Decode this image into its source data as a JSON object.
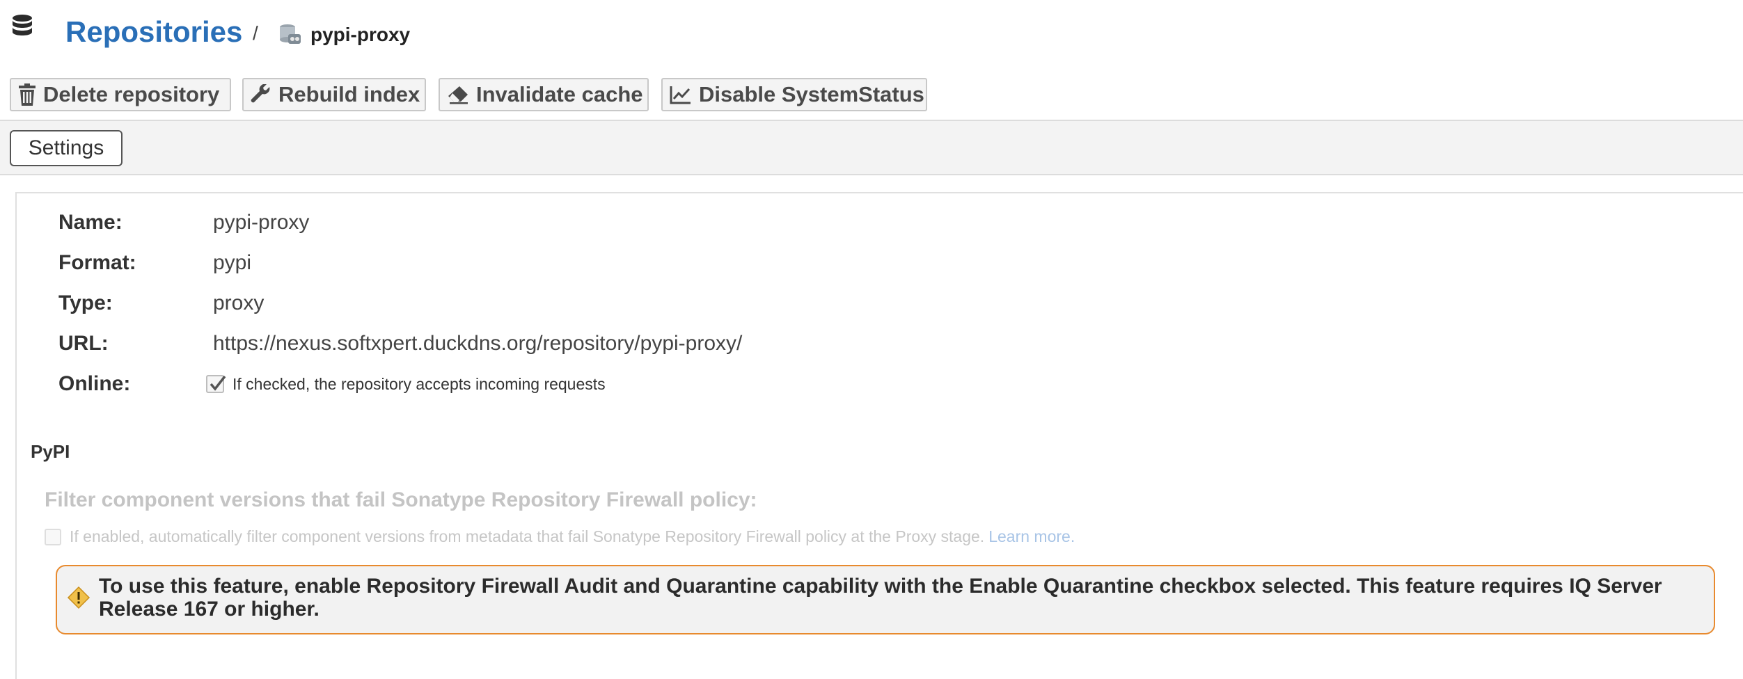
{
  "breadcrumb": {
    "root_label": "Repositories",
    "separator": "/",
    "current_label": "pypi-proxy"
  },
  "toolbar": {
    "delete_label": "Delete repository",
    "rebuild_label": "Rebuild index",
    "invalidate_label": "Invalidate cache",
    "disable_status_label": "Disable SystemStatus"
  },
  "tabs": {
    "settings_label": "Settings"
  },
  "fields": {
    "name_label": "Name:",
    "name_value": "pypi-proxy",
    "format_label": "Format:",
    "format_value": "pypi",
    "type_label": "Type:",
    "type_value": "proxy",
    "url_label": "URL:",
    "url_value": "https://nexus.softxpert.duckdns.org/repository/pypi-proxy/",
    "online_label": "Online:",
    "online_checked": true,
    "online_help": "If checked, the repository accepts incoming requests"
  },
  "pypi_section": {
    "title": "PyPI",
    "filter_title": "Filter component versions that fail Sonatype Repository Firewall policy:",
    "filter_checked": false,
    "filter_help": "If enabled, automatically filter component versions from metadata that fail Sonatype Repository Firewall policy at the Proxy stage.",
    "learn_more": "Learn more.",
    "warning_text": "To use this feature, enable Repository Firewall Audit and Quarantine capability with the Enable Quarantine checkbox selected. This feature requires IQ Server Release 167 or higher."
  },
  "colors": {
    "breadcrumb_link": "#2a6fb7",
    "warning_border": "#e88a2e",
    "warning_icon": "#f0c04a"
  },
  "icons": {
    "header": "database-icon",
    "repo": "repository-icon",
    "delete": "trash-icon",
    "rebuild": "wrench-icon",
    "invalidate": "eraser-icon",
    "status": "chart-line-icon",
    "warning": "warning-icon"
  }
}
